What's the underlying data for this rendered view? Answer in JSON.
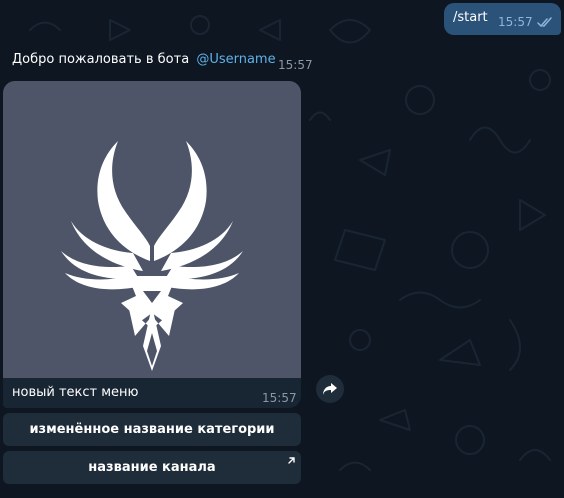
{
  "outgoing": {
    "text": "/start",
    "time": "15:57",
    "status_icon": "double-check-icon"
  },
  "welcome": {
    "text": "Добро пожаловать в бота",
    "mention": "@Username",
    "time": "15:57"
  },
  "photo_message": {
    "image_icon": "winged-emblem",
    "caption": "новый текст меню",
    "time": "15:57"
  },
  "keyboard": {
    "buttons": [
      {
        "label": "изменённое название категории"
      },
      {
        "label": "название канала",
        "icon": "external-link-arrow-icon"
      }
    ]
  },
  "colors": {
    "background": "#0e1621",
    "outgoing_bubble": "#2b5278",
    "incoming_bubble": "#182533",
    "button": "#1f2c3a",
    "link": "#5fb1e8",
    "photo_bg": "#4e5568"
  }
}
